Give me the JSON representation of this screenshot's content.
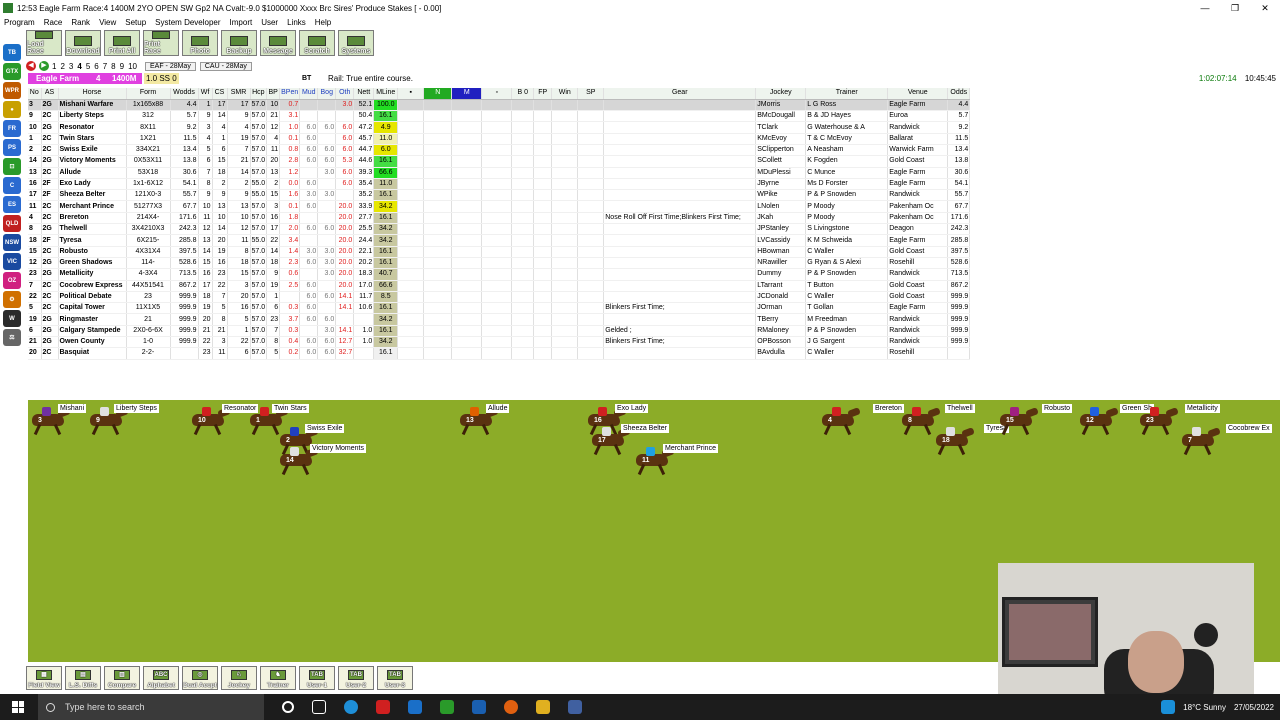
{
  "window": {
    "title": "12:53 Eagle Farm Race:4 1400M 2YO  OPEN SW Gp2  NA Cvalt:-9.0 $1000000 Xxxx Brc Sires' Produce Stakes [ - 0.00]",
    "minimize": "—",
    "maximize": "❐",
    "close": "✕"
  },
  "menu": [
    "Program",
    "Race",
    "Rank",
    "View",
    "Setup",
    "System Developer",
    "Import",
    "User",
    "Links",
    "Help"
  ],
  "toolbar": [
    {
      "label": "Load Race"
    },
    {
      "label": "Download"
    },
    {
      "label": "Print All"
    },
    {
      "label": "Print Race"
    },
    {
      "label": "Photo"
    },
    {
      "label": "Backup"
    },
    {
      "label": "Message"
    },
    {
      "label": "Scratch"
    },
    {
      "label": "Systems"
    }
  ],
  "leftbar": [
    {
      "label": "TB",
      "color": "#1a6fc8"
    },
    {
      "label": "GTX",
      "color": "#2a9a2a"
    },
    {
      "label": "WPR",
      "color": "#c05a00"
    },
    {
      "label": "●",
      "color": "#c8a000"
    },
    {
      "label": "FR",
      "color": "#2a6ad0"
    },
    {
      "label": "PS",
      "color": "#2a6ad0"
    },
    {
      "label": "⊡",
      "color": "#2a9a2a"
    },
    {
      "label": "C",
      "color": "#2a6ad0"
    },
    {
      "label": "ES",
      "color": "#2a6ad0"
    },
    {
      "label": "QLD",
      "color": "#c02020"
    },
    {
      "label": "NSW",
      "color": "#1a4aa0"
    },
    {
      "label": "VIC",
      "color": "#1a4aa0"
    },
    {
      "label": "OZ",
      "color": "#d02080"
    },
    {
      "label": "⚙",
      "color": "#d07000"
    },
    {
      "label": "W",
      "color": "#2a2a2a"
    },
    {
      "label": "⚖",
      "color": "#666"
    }
  ],
  "race_tabs": [
    "1",
    "2",
    "3",
    "4",
    "5",
    "6",
    "7",
    "8",
    "9",
    "10"
  ],
  "meet_tabs": [
    "EAF - 28May",
    "CAU - 28May"
  ],
  "race_info": {
    "venue": "Eagle Farm",
    "race": "4",
    "distance": "1400M",
    "misc": "1.0  SS  0",
    "bt": "BT",
    "rail": "Rail: True entire course.",
    "clock_elapsed": "1:02:07:14",
    "clock_time": "10:45:45"
  },
  "columns": [
    "No",
    "AS",
    "Horse",
    "Form",
    "Wodds",
    "Wf",
    "CS",
    "SMR",
    "Hcp",
    "BP",
    "BPen",
    "Mud",
    "Bog",
    "Oth",
    "Nett",
    "MLine",
    "▪",
    "N",
    "M",
    "▫",
    "B 0",
    "FP",
    "Win",
    "SP",
    "Gear",
    "Jockey",
    "Trainer",
    "Venue",
    "Odds"
  ],
  "rows": [
    {
      "no": "3",
      "as": "2G",
      "horse": "Mishani Warfare",
      "form": "1x165x88",
      "wodds": "4.4",
      "wf": "1",
      "cs": "17",
      "smr": "17",
      "hcp": "57.0",
      "bp": "10",
      "bpen": "0.7",
      "mud": "",
      "bog": "",
      "oth": "3.0",
      "nett": "52.1",
      "mline": "100.0",
      "mcol": "#22dd22",
      "gear": "",
      "jockey": "JMorris",
      "trainer": "L G Ross",
      "venue": "Eagle Farm",
      "odds": "4.4",
      "sel": true
    },
    {
      "no": "9",
      "as": "2C",
      "horse": "Liberty Steps",
      "form": "312",
      "wodds": "5.7",
      "wf": "9",
      "cs": "14",
      "smr": "9",
      "hcp": "57.0",
      "bp": "21",
      "bpen": "3.1",
      "mud": "",
      "bog": "",
      "oth": "",
      "nett": "50.4",
      "mline": "16.1",
      "mcol": "#44dd44",
      "gear": "",
      "jockey": "BMcDougall",
      "trainer": "B & JD Hayes",
      "venue": "Euroa",
      "odds": "5.7"
    },
    {
      "no": "10",
      "as": "2G",
      "horse": "Resonator",
      "form": "8X11",
      "wodds": "9.2",
      "wf": "3",
      "cs": "4",
      "smr": "4",
      "hcp": "57.0",
      "bp": "12",
      "bpen": "1.0",
      "mud": "6.0",
      "bog": "6.0",
      "oth": "6.0",
      "nett": "47.2",
      "mline": "4.9",
      "mcol": "#e6e600",
      "gear": "",
      "jockey": "TClark",
      "trainer": "G Waterhouse & A",
      "venue": "Randwick",
      "odds": "9.2"
    },
    {
      "no": "1",
      "as": "2C",
      "horse": "Twin Stars",
      "form": "1X21",
      "wodds": "11.5",
      "wf": "4",
      "cs": "1",
      "smr": "19",
      "hcp": "57.0",
      "bp": "4",
      "bpen": "0.1",
      "mud": "6.0",
      "bog": "",
      "oth": "6.0",
      "nett": "45.7",
      "mline": "11.0",
      "mcol": "#f0f0b0",
      "gear": "",
      "jockey": "KMcEvoy",
      "trainer": "T & C McEvoy",
      "venue": "Ballarat",
      "odds": "11.5"
    },
    {
      "no": "2",
      "as": "2C",
      "horse": "Swiss Exile",
      "form": "334X21",
      "wodds": "13.4",
      "wf": "5",
      "cs": "6",
      "smr": "7",
      "hcp": "57.0",
      "bp": "11",
      "bpen": "0.8",
      "mud": "6.0",
      "bog": "6.0",
      "oth": "6.0",
      "nett": "44.7",
      "mline": "6.0",
      "mcol": "#e6e600",
      "gear": "",
      "jockey": "SClipperton",
      "trainer": "A Neasham",
      "venue": "Warwick Farm",
      "odds": "13.4"
    },
    {
      "no": "14",
      "as": "2G",
      "horse": "Victory Moments",
      "form": "0X53X11",
      "wodds": "13.8",
      "wf": "6",
      "cs": "15",
      "smr": "21",
      "hcp": "57.0",
      "bp": "20",
      "bpen": "2.8",
      "mud": "6.0",
      "bog": "6.0",
      "oth": "5.3",
      "nett": "44.6",
      "mline": "16.1",
      "mcol": "#44dd44",
      "gear": "",
      "jockey": "SCollett",
      "trainer": "K Fogden",
      "venue": "Gold Coast",
      "odds": "13.8"
    },
    {
      "no": "13",
      "as": "2C",
      "horse": "Allude",
      "form": "53X18",
      "wodds": "30.6",
      "wf": "7",
      "cs": "18",
      "smr": "14",
      "hcp": "57.0",
      "bp": "13",
      "bpen": "1.2",
      "mud": "",
      "bog": "3.0",
      "oth": "6.0",
      "nett": "39.3",
      "mline": "66.6",
      "mcol": "#22dd22",
      "gear": "",
      "jockey": "MDuPlessi",
      "trainer": "C Munce",
      "venue": "Eagle Farm",
      "odds": "30.6"
    },
    {
      "no": "16",
      "as": "2F",
      "horse": "Exo Lady",
      "form": "1x1-6X12",
      "wodds": "54.1",
      "wf": "8",
      "cs": "2",
      "smr": "2",
      "hcp": "55.0",
      "bp": "2",
      "bpen": "0.0",
      "mud": "6.0",
      "bog": "",
      "oth": "6.0",
      "nett": "35.4",
      "mline": "11.0",
      "mcol": "#c8c8a0",
      "gear": "",
      "jockey": "JByrne",
      "trainer": "Ms D Forster",
      "venue": "Eagle Farm",
      "odds": "54.1"
    },
    {
      "no": "17",
      "as": "2F",
      "horse": "Sheeza Belter",
      "form": "121X0-3",
      "wodds": "55.7",
      "wf": "9",
      "cs": "9",
      "smr": "9",
      "hcp": "55.0",
      "bp": "15",
      "bpen": "1.6",
      "mud": "3.0",
      "bog": "3.0",
      "oth": "",
      "nett": "35.2",
      "mline": "16.1",
      "mcol": "#c8c8a0",
      "gear": "",
      "jockey": "WPike",
      "trainer": "P & P Snowden",
      "venue": "Randwick",
      "odds": "55.7"
    },
    {
      "no": "11",
      "as": "2C",
      "horse": "Merchant Prince",
      "form": "51277X3",
      "wodds": "67.7",
      "wf": "10",
      "cs": "13",
      "smr": "13",
      "hcp": "57.0",
      "bp": "3",
      "bpen": "0.1",
      "mud": "6.0",
      "bog": "",
      "oth": "20.0",
      "nett": "33.9",
      "mline": "34.2",
      "mcol": "#e6e600",
      "gear": "",
      "jockey": "LNolen",
      "trainer": "P Moody",
      "venue": "Pakenham Oc",
      "odds": "67.7"
    },
    {
      "no": "4",
      "as": "2C",
      "horse": "Brereton",
      "form": "214X4-",
      "wodds": "171.6",
      "wf": "11",
      "cs": "10",
      "smr": "10",
      "hcp": "57.0",
      "bp": "16",
      "bpen": "1.8",
      "mud": "",
      "bog": "",
      "oth": "20.0",
      "nett": "27.7",
      "mline": "16.1",
      "mcol": "#c8c8a0",
      "gear": "Nose Roll Off First Time;Blinkers First Time;",
      "jockey": "JKah",
      "trainer": "P Moody",
      "venue": "Pakenham Oc",
      "odds": "171.6"
    },
    {
      "no": "8",
      "as": "2G",
      "horse": "Thelwell",
      "form": "3X4210X3",
      "wodds": "242.3",
      "wf": "12",
      "cs": "14",
      "smr": "12",
      "hcp": "57.0",
      "bp": "17",
      "bpen": "2.0",
      "mud": "6.0",
      "bog": "6.0",
      "oth": "20.0",
      "nett": "25.5",
      "mline": "34.2",
      "mcol": "#c8c8a0",
      "gear": "",
      "jockey": "JPStanley",
      "trainer": "S Livingstone",
      "venue": "Deagon",
      "odds": "242.3"
    },
    {
      "no": "18",
      "as": "2F",
      "horse": "Tyresa",
      "form": "6X215-",
      "wodds": "285.8",
      "wf": "13",
      "cs": "20",
      "smr": "11",
      "hcp": "55.0",
      "bp": "22",
      "bpen": "3.4",
      "mud": "",
      "bog": "",
      "oth": "20.0",
      "nett": "24.4",
      "mline": "34.2",
      "mcol": "#c8c8a0",
      "gear": "",
      "jockey": "LVCassidy",
      "trainer": "K M Schweida",
      "venue": "Eagle Farm",
      "odds": "285.8"
    },
    {
      "no": "15",
      "as": "2C",
      "horse": "Robusto",
      "form": "4X31X4",
      "wodds": "397.5",
      "wf": "14",
      "cs": "19",
      "smr": "8",
      "hcp": "57.0",
      "bp": "14",
      "bpen": "1.4",
      "mud": "3.0",
      "bog": "3.0",
      "oth": "20.0",
      "nett": "22.1",
      "mline": "16.1",
      "mcol": "#c8c8a0",
      "gear": "",
      "jockey": "HBowman",
      "trainer": "C Waller",
      "venue": "Gold Coast",
      "odds": "397.5"
    },
    {
      "no": "12",
      "as": "2G",
      "horse": "Green Shadows",
      "form": "114-",
      "wodds": "528.6",
      "wf": "15",
      "cs": "16",
      "smr": "18",
      "hcp": "57.0",
      "bp": "18",
      "bpen": "2.3",
      "mud": "6.0",
      "bog": "3.0",
      "oth": "20.0",
      "nett": "20.2",
      "mline": "16.1",
      "mcol": "#c8c8a0",
      "gear": "",
      "jockey": "NRawiller",
      "trainer": "G Ryan & S Alexi",
      "venue": "Rosehill",
      "odds": "528.6"
    },
    {
      "no": "23",
      "as": "2G",
      "horse": "Metallicity",
      "form": "4-3X4",
      "wodds": "713.5",
      "wf": "16",
      "cs": "23",
      "smr": "15",
      "hcp": "57.0",
      "bp": "9",
      "bpen": "0.6",
      "mud": "",
      "bog": "3.0",
      "oth": "20.0",
      "nett": "18.3",
      "mline": "40.7",
      "mcol": "#c8c8a0",
      "gear": "",
      "jockey": "Dummy",
      "trainer": "P & P Snowden",
      "venue": "Randwick",
      "odds": "713.5"
    },
    {
      "no": "7",
      "as": "2C",
      "horse": "Cocobrew Express",
      "form": "44X51541",
      "wodds": "867.2",
      "wf": "17",
      "cs": "22",
      "smr": "3",
      "hcp": "57.0",
      "bp": "19",
      "bpen": "2.5",
      "mud": "6.0",
      "bog": "",
      "oth": "20.0",
      "nett": "17.0",
      "mline": "66.6",
      "mcol": "#c8c8a0",
      "gear": "",
      "jockey": "LTarrant",
      "trainer": "T Button",
      "venue": "Gold Coast",
      "odds": "867.2"
    },
    {
      "no": "22",
      "as": "2C",
      "horse": "Political Debate",
      "form": "23",
      "wodds": "999.9",
      "wf": "18",
      "cs": "7",
      "smr": "20",
      "hcp": "57.0",
      "bp": "1",
      "bpen": "",
      "mud": "6.0",
      "bog": "6.0",
      "oth": "14.1",
      "nett": "11.7",
      "mline": "8.5",
      "mcol": "#c8c8a0",
      "gear": "",
      "jockey": "JCDonald",
      "trainer": "C Waller",
      "venue": "Gold Coast",
      "odds": "999.9"
    },
    {
      "no": "5",
      "as": "2C",
      "horse": "Capital Tower",
      "form": "11X1X5",
      "wodds": "999.9",
      "wf": "19",
      "cs": "5",
      "smr": "16",
      "hcp": "57.0",
      "bp": "6",
      "bpen": "0.3",
      "mud": "6.0",
      "bog": "",
      "oth": "14.1",
      "nett": "10.6",
      "mline": "16.1",
      "mcol": "#c8c8a0",
      "gear": "Blinkers First Time;",
      "jockey": "JOrman",
      "trainer": "T Gollan",
      "venue": "Eagle Farm",
      "odds": "999.9"
    },
    {
      "no": "19",
      "as": "2G",
      "horse": "Ringmaster",
      "form": "21",
      "wodds": "999.9",
      "wf": "20",
      "cs": "8",
      "smr": "5",
      "hcp": "57.0",
      "bp": "23",
      "bpen": "3.7",
      "mud": "6.0",
      "bog": "6.0",
      "oth": "",
      "nett": "",
      "mline": "34.2",
      "mcol": "#c8c8a0",
      "gear": "",
      "jockey": "TBerry",
      "trainer": "M Freedman",
      "venue": "Randwick",
      "odds": "999.9"
    },
    {
      "no": "6",
      "as": "2G",
      "horse": "Calgary Stampede",
      "form": "2X0-6-6X",
      "wodds": "999.9",
      "wf": "21",
      "cs": "21",
      "smr": "1",
      "hcp": "57.0",
      "bp": "7",
      "bpen": "0.3",
      "mud": "",
      "bog": "3.0",
      "oth": "14.1",
      "nett": "1.0",
      "mline": "16.1",
      "mcol": "#c8c8a0",
      "gear": "Gelded ;",
      "jockey": "RMaloney",
      "trainer": "P & P Snowden",
      "venue": "Randwick",
      "odds": "999.9"
    },
    {
      "no": "21",
      "as": "2G",
      "horse": "Owen County",
      "form": "1-0",
      "wodds": "999.9",
      "wf": "22",
      "cs": "3",
      "smr": "22",
      "hcp": "57.0",
      "bp": "8",
      "bpen": "0.4",
      "mud": "6.0",
      "bog": "6.0",
      "oth": "12.7",
      "nett": "1.0",
      "mline": "34.2",
      "mcol": "#c8c8a0",
      "gear": "Blinkers First Time;",
      "jockey": "OPBosson",
      "trainer": "J G Sargent",
      "venue": "Randwick",
      "odds": "999.9"
    },
    {
      "no": "20",
      "as": "2C",
      "horse": "Basquiat",
      "form": "2-2-",
      "wodds": "",
      "wf": "23",
      "cs": "11",
      "smr": "6",
      "hcp": "57.0",
      "bp": "5",
      "bpen": "0.2",
      "mud": "6.0",
      "bog": "6.0",
      "oth": "32.7",
      "nett": "",
      "mline": "16.1",
      "mcol": "#f0f0f0",
      "gear": "",
      "jockey": "BAvdulla",
      "trainer": "C Waller",
      "venue": "Rosehill",
      "odds": ""
    }
  ],
  "track_horses": [
    {
      "num": "3",
      "name": "Mishani",
      "silk": "#7030a0"
    },
    {
      "num": "9",
      "name": "Liberty Steps",
      "silk": "#e0e0e0"
    },
    {
      "num": "10",
      "name": "Resonator",
      "silk": "#d02020"
    },
    {
      "num": "1",
      "name": "Twin Stars",
      "silk": "#d02020"
    },
    {
      "num": "2",
      "name": "Swiss Exile",
      "silk": "#2040c0"
    },
    {
      "num": "14",
      "name": "Victory Moments",
      "silk": "#e0e0e0"
    },
    {
      "num": "13",
      "name": "Allude",
      "silk": "#e06000"
    },
    {
      "num": "16",
      "name": "Exo Lady",
      "silk": "#d02020"
    },
    {
      "num": "17",
      "name": "Sheeza Belter",
      "silk": "#e0e0e0"
    },
    {
      "num": "11",
      "name": "Merchant Prince",
      "silk": "#20a0e0"
    },
    {
      "num": "4",
      "name": "Brereton",
      "silk": "#d02020"
    },
    {
      "num": "8",
      "name": "Thelwell",
      "silk": "#d02020"
    },
    {
      "num": "18",
      "name": "Tyresa",
      "silk": "#e0e0e0"
    },
    {
      "num": "15",
      "name": "Robusto",
      "silk": "#a02080"
    },
    {
      "num": "12",
      "name": "Green Sh",
      "silk": "#2060e0"
    },
    {
      "num": "23",
      "name": "Metallicity",
      "silk": "#d02020"
    },
    {
      "num": "7",
      "name": "Cocobrew Ex",
      "silk": "#e0e0e0"
    }
  ],
  "bottom_toolbar": [
    {
      "label": "Field View",
      "icon": "▦"
    },
    {
      "label": "L.S. Diffs",
      "icon": "▤"
    },
    {
      "label": "Compare",
      "icon": "▥"
    },
    {
      "label": "Alphabet",
      "icon": "ABC"
    },
    {
      "label": "Dual Accpt",
      "icon": "◎"
    },
    {
      "label": "Jockey",
      "icon": "♘"
    },
    {
      "label": "Trainer",
      "icon": "♞"
    },
    {
      "label": "User-1",
      "icon": "TAB"
    },
    {
      "label": "User-2",
      "icon": "TAB"
    },
    {
      "label": "User-3",
      "icon": "TAB"
    }
  ],
  "taskbar": {
    "search_placeholder": "Type here to search",
    "weather": "18°C  Sunny",
    "date": "27/05/2022"
  }
}
